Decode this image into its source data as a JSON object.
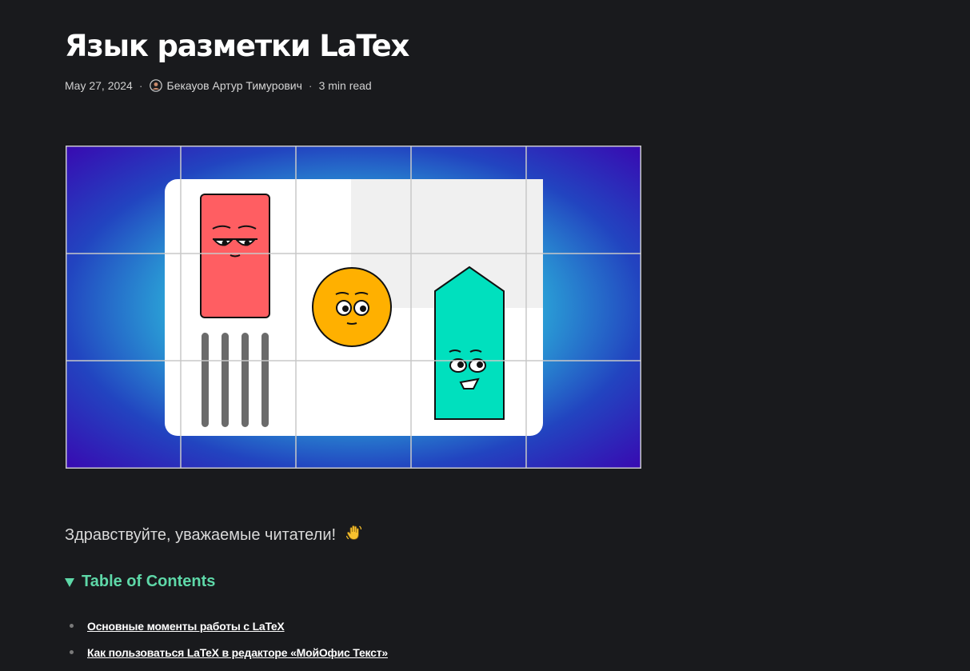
{
  "article": {
    "title": "Язык разметки LaTex",
    "date": "May 27, 2024",
    "separator": "·",
    "author": "Бекауов Артур Тимурович",
    "read_time": "3 min read",
    "greeting": "Здравствуйте, уважаемые читатели!",
    "greeting_emoji": "waving-hand-icon"
  },
  "toc": {
    "summary": "Table of Contents",
    "items": [
      "Основные моменты работы с LaTeX",
      "Как пользоваться LaTeX в редакторе «МойОфис Текст»"
    ]
  },
  "colors": {
    "background": "#191a1d",
    "toc_accent": "#5ed8a8",
    "hero_purple": "#3a05b0",
    "hero_blue": "#2a9fd6",
    "red_character": "#ff5e62",
    "yellow_character": "#ffb000",
    "teal_character": "#00e0be"
  }
}
